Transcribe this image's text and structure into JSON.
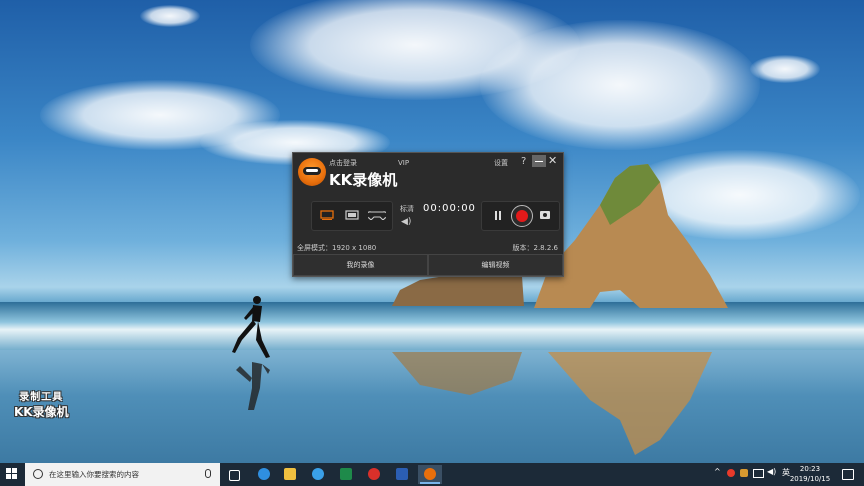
{
  "recorder": {
    "login_label": "点击登录",
    "vip_label": "VIP",
    "brand_title": "KK录像机",
    "settings_label": "设置",
    "help_label": "?",
    "close_label": "✕",
    "quality_label": "标清",
    "speaker_icon": "speaker-icon",
    "timer": "00:00:00",
    "fullscreen_mode": "全屏模式：1920 x 1080",
    "version": "版本：2.8.2.6",
    "my_recordings_label": "我的录像",
    "edit_video_label": "编辑视频",
    "record_color": "#e31a1a",
    "accent_color": "#e86f0c"
  },
  "watermark": {
    "line1": "录制工具",
    "line2": "KK录像机"
  },
  "taskbar": {
    "search_placeholder": "在这里输入你要搜索的内容",
    "ime_label": "英",
    "time": "20:23",
    "date": "2019/10/15",
    "apps": [
      "task-view",
      "edge",
      "file-explorer",
      "network",
      "pycharm",
      "netease-music",
      "word",
      "kk-recorder"
    ]
  }
}
